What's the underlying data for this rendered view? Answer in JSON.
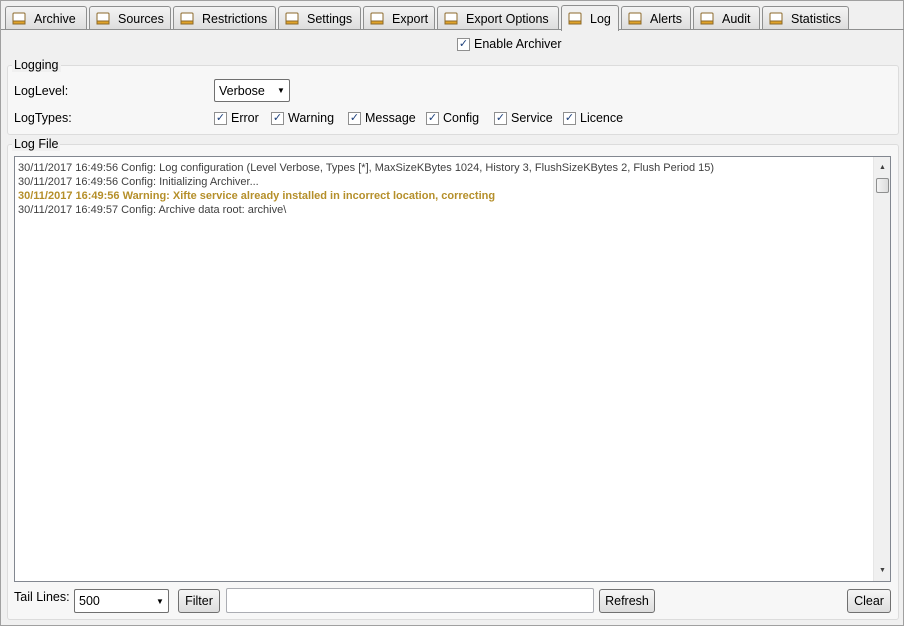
{
  "tabs": [
    {
      "label": "Archive",
      "icon": "archive-tab-icon"
    },
    {
      "label": "Sources",
      "icon": "sources-tab-icon"
    },
    {
      "label": "Restrictions",
      "icon": "restrictions-tab-icon"
    },
    {
      "label": "Settings",
      "icon": "settings-tab-icon"
    },
    {
      "label": "Export",
      "icon": "export-tab-icon"
    },
    {
      "label": "Export Options",
      "icon": "export-options-tab-icon"
    },
    {
      "label": "Log",
      "icon": "log-tab-icon"
    },
    {
      "label": "Alerts",
      "icon": "alerts-tab-icon"
    },
    {
      "label": "Audit",
      "icon": "audit-tab-icon"
    },
    {
      "label": "Statistics",
      "icon": "statistics-tab-icon"
    }
  ],
  "active_tab": "Log",
  "enable_archiver": {
    "label": "Enable Archiver",
    "checked": true
  },
  "logging": {
    "group_label": "Logging",
    "loglevel_label": "LogLevel:",
    "loglevel_value": "Verbose",
    "logtypes_label": "LogTypes:",
    "types": [
      {
        "label": "Error",
        "checked": true
      },
      {
        "label": "Warning",
        "checked": true
      },
      {
        "label": "Message",
        "checked": true
      },
      {
        "label": "Config",
        "checked": true
      },
      {
        "label": "Service",
        "checked": true
      },
      {
        "label": "Licence",
        "checked": true
      }
    ]
  },
  "logfile": {
    "group_label": "Log File",
    "lines": [
      {
        "text": "30/11/2017 16:49:56 Config: Log configuration (Level Verbose, Types [*], MaxSizeKBytes 1024, History 3, FlushSizeKBytes 2, Flush Period 15)",
        "level": "config"
      },
      {
        "text": "30/11/2017 16:49:56 Config: Initializing Archiver...",
        "level": "config"
      },
      {
        "text": "30/11/2017 16:49:56 Warning: Xifte service already installed in incorrect location, correcting",
        "level": "warning"
      },
      {
        "text": "30/11/2017 16:49:57 Config: Archive data root: archive\\",
        "level": "config"
      }
    ]
  },
  "footer": {
    "tail_lines_label": "Tail Lines:",
    "tail_lines_value": "500",
    "filter_button": "Filter",
    "filter_text": "",
    "refresh_button": "Refresh",
    "clear_button": "Clear"
  },
  "colors": {
    "warning_text": "#b58f2a",
    "log_text": "#404040",
    "tab_icon": "#e0a32a"
  }
}
